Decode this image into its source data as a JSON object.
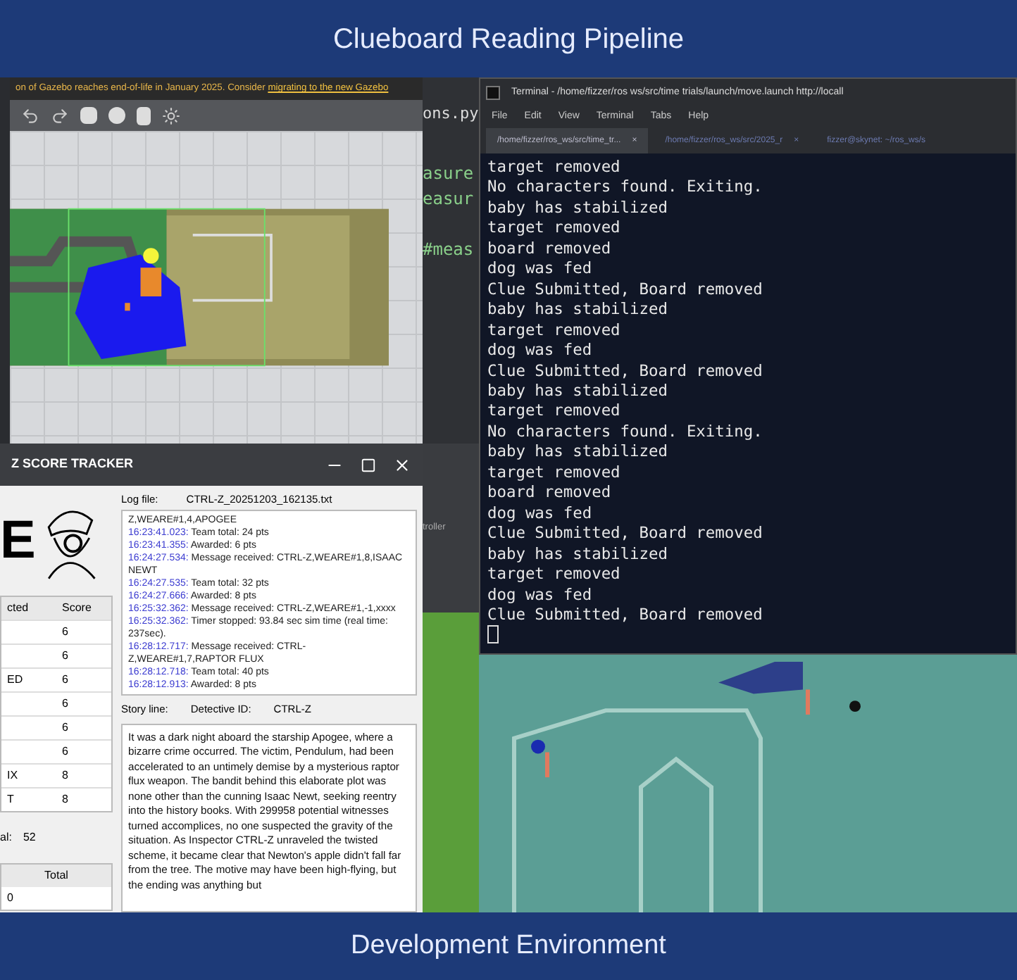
{
  "header": {
    "title": "Clueboard Reading Pipeline"
  },
  "gazebo": {
    "warning": "on of Gazebo reaches end-of-life in January 2025. Consider",
    "warning_link": "migrating to the new Gazebo"
  },
  "editor": {
    "tab": "ons.py",
    "lines": [
      "asure",
      "easur",
      "#meas"
    ]
  },
  "terminal": {
    "title": "Terminal - /home/fizzer/ros ws/src/time trials/launch/move.launch http://locall",
    "menu": [
      "File",
      "Edit",
      "View",
      "Terminal",
      "Tabs",
      "Help"
    ],
    "tabs": [
      {
        "label": "/home/fizzer/ros_ws/src/time_tr...",
        "close": "×",
        "selected": true
      },
      {
        "label": "/home/fizzer/ros_ws/src/2025_r",
        "close": "×",
        "selected": false
      },
      {
        "label": "fizzer@skynet: ~/ros_ws/s",
        "selected": false
      }
    ],
    "lines": [
      "target removed",
      "No characters found. Exiting.",
      "baby has stabilized",
      "target removed",
      "board removed",
      "dog was fed",
      "Clue Submitted, Board removed",
      "baby has stabilized",
      "target removed",
      "dog was fed",
      "Clue Submitted, Board removed",
      "baby has stabilized",
      "target removed",
      "No characters found. Exiting.",
      "baby has stabilized",
      "target removed",
      "board removed",
      "dog was fed",
      "Clue Submitted, Board removed",
      "baby has stabilized",
      "target removed",
      "dog was fed",
      "Clue Submitted, Board removed"
    ]
  },
  "controller_label": "troller",
  "tracker": {
    "title": "Z SCORE TRACKER",
    "logo_letter": "E",
    "table": {
      "columns": [
        "cted",
        "Score"
      ],
      "rows": [
        [
          "",
          "6"
        ],
        [
          "",
          "6"
        ],
        [
          "ED",
          "6"
        ],
        [
          "",
          "6"
        ],
        [
          "",
          "6"
        ],
        [
          "",
          "6"
        ],
        [
          "IX",
          "8"
        ],
        [
          "T",
          "8"
        ]
      ]
    },
    "total_label": "al:",
    "total_value": "52",
    "table2": {
      "columns": [
        "Total"
      ],
      "rows": [
        "0"
      ]
    },
    "log_label": "Log file:",
    "log_file": "CTRL-Z_20251203_162135.txt",
    "log": [
      {
        "text": "Z,WEARE#1,4,APOGEE"
      },
      {
        "time": "16:23:41.023:",
        "text": "Team total: 24 pts"
      },
      {
        "time": "16:23:41.355:",
        "text": "Awarded: 6 pts"
      },
      {
        "time": "16:24:27.534:",
        "text": "Message received: CTRL-Z,WEARE#1,8,ISAAC NEWT"
      },
      {
        "time": "16:24:27.535:",
        "text": "Team total: 32 pts"
      },
      {
        "time": "16:24:27.666:",
        "text": "Awarded: 8 pts"
      },
      {
        "time": "16:25:32.362:",
        "text": "Message received: CTRL-Z,WEARE#1,-1,xxxx"
      },
      {
        "time": "16:25:32.362:",
        "text": "Timer stopped: 93.84 sec sim time (real time: 237sec)."
      },
      {
        "time": "16:28:12.717:",
        "text": "Message received: CTRL-Z,WEARE#1,7,RAPTOR FLUX"
      },
      {
        "time": "16:28:12.718:",
        "text": "Team total: 40 pts"
      },
      {
        "time": "16:28:12.913:",
        "text": "Awarded: 8 pts"
      }
    ],
    "story_label": "Story line:",
    "detective_label": "Detective ID:",
    "detective_id": "CTRL-Z",
    "story": "It was a dark night aboard the starship Apogee, where a bizarre crime occurred. The victim, Pendulum, had been accelerated to an untimely demise by a mysterious raptor flux weapon. The bandit behind this elaborate plot was none other than the cunning Isaac Newt, seeking reentry into the history books. With 299958 potential witnesses turned accomplices, no one suspected the gravity of the situation. As Inspector CTRL-Z unraveled the twisted scheme, it became clear that Newton's apple didn't fall far from the tree. The motive may have been high-flying, but the ending was anything but"
  },
  "footer": {
    "title": "Development Environment"
  }
}
